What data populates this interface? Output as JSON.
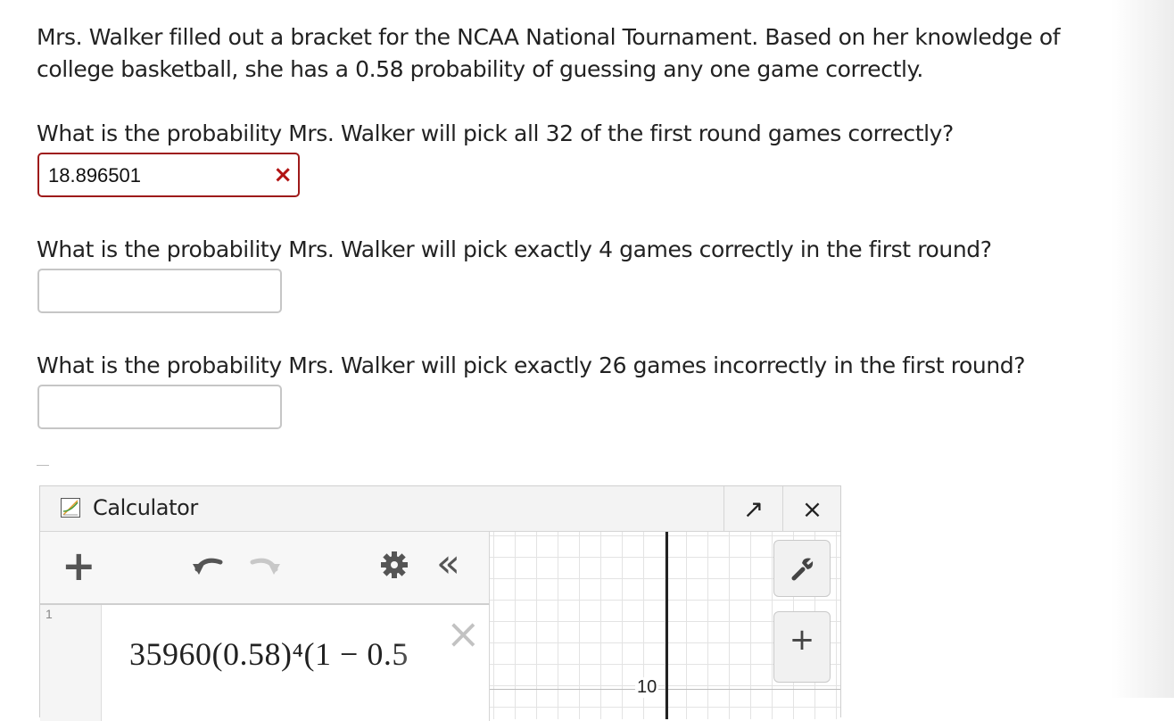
{
  "problem": {
    "prompt": "Mrs. Walker filled out a bracket for the NCAA National Tournament. Based on her knowledge of college basketball, she has a 0.58 probability of guessing any one game correctly.",
    "questions": [
      {
        "text": "What is the probability Mrs. Walker will pick all 32 of the first round games correctly?",
        "answer": "18.896501",
        "status": "incorrect",
        "status_icon": "×"
      },
      {
        "text": "What is the probability Mrs. Walker will pick exactly 4 games correctly in the first round?",
        "answer": ""
      },
      {
        "text": "What is the probability Mrs. Walker will pick exactly 26 games incorrectly in the first round?",
        "answer": ""
      }
    ]
  },
  "calculator": {
    "title": "Calculator",
    "logo_icon": "calculator-graph-icon",
    "expand_icon": "↗",
    "close_icon": "×",
    "toolbar": {
      "add": "+",
      "undo_icon": "undo-icon",
      "redo_icon": "redo-icon",
      "settings_icon": "gear-icon",
      "collapse": "«"
    },
    "expression": {
      "index": "1",
      "latex_display": "35960(0.58)⁴(1 − 0.5",
      "delete": "×"
    },
    "graph": {
      "tick_label": "10",
      "wrench_icon": "wrench-icon",
      "zoom_in": "+"
    }
  },
  "colors": {
    "error": "#b21414",
    "error_border": "#9e1a1a",
    "input_border": "#c6c6c6"
  }
}
